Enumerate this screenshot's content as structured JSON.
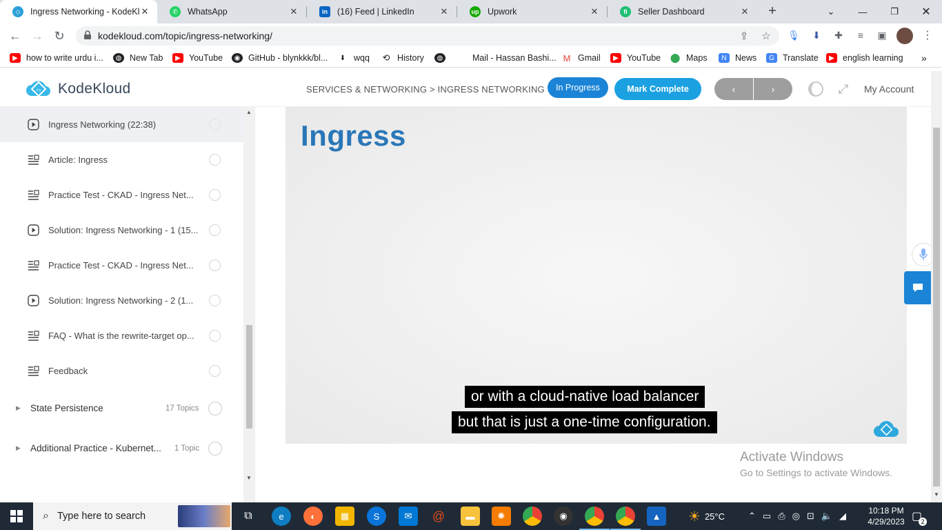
{
  "browser": {
    "tabs": [
      {
        "title": "Ingress Networking - KodeKl",
        "favicon_color": "#2b9fd8",
        "active": true
      },
      {
        "title": "WhatsApp",
        "favicon_color": "#25d366",
        "active": false
      },
      {
        "title": "(16) Feed | LinkedIn",
        "favicon_color": "#0a66c2",
        "active": false
      },
      {
        "title": "Upwork",
        "favicon_color": "#14a800",
        "active": false
      },
      {
        "title": "Seller Dashboard",
        "favicon_color": "#1dbf73",
        "active": false
      }
    ],
    "url": "kodekloud.com/topic/ingress-networking/",
    "bookmarks": [
      {
        "label": "how to write urdu i...",
        "icon": "youtube-icon",
        "color": "#ff0000"
      },
      {
        "label": "New Tab",
        "icon": "globe-icon",
        "color": "#202124"
      },
      {
        "label": "YouTube",
        "icon": "youtube-icon",
        "color": "#ff0000"
      },
      {
        "label": "GitHub - blynkkk/bl...",
        "icon": "github-icon",
        "color": "#202124"
      },
      {
        "label": "wqq",
        "icon": "download-icon",
        "color": "#202124"
      },
      {
        "label": "History",
        "icon": "history-icon",
        "color": "#202124"
      },
      {
        "label": "",
        "icon": "globe-icon",
        "color": "#202124"
      },
      {
        "label": "Mail - Hassan Bashi...",
        "icon": "microsoft-icon",
        "color": "#f25022"
      },
      {
        "label": "Gmail",
        "icon": "gmail-icon",
        "color": "#ea4335"
      },
      {
        "label": "YouTube",
        "icon": "youtube-icon",
        "color": "#ff0000"
      },
      {
        "label": "Maps",
        "icon": "maps-icon",
        "color": "#34a853"
      },
      {
        "label": "News",
        "icon": "news-icon",
        "color": "#4285f4"
      },
      {
        "label": "Translate",
        "icon": "translate-icon",
        "color": "#4285f4"
      },
      {
        "label": "english learning",
        "icon": "youtube-icon",
        "color": "#ff0000"
      }
    ]
  },
  "header": {
    "brand": "KodeKloud",
    "breadcrumb": "SERVICES & NETWORKING > INGRESS NETWORKING",
    "status_label": "In Progress",
    "complete_label": "Mark Complete",
    "prev_label": "‹",
    "next_label": "›",
    "account_label": "My Account"
  },
  "sidebar": {
    "lessons": [
      {
        "label": "Ingress Networking (22:38)",
        "type": "video",
        "current": true
      },
      {
        "label": "Article: Ingress",
        "type": "article",
        "current": false
      },
      {
        "label": "Practice Test - CKAD - Ingress Net...",
        "type": "article",
        "current": false
      },
      {
        "label": "Solution: Ingress Networking - 1 (15...",
        "type": "video",
        "current": false
      },
      {
        "label": "Practice Test - CKAD - Ingress Net...",
        "type": "article",
        "current": false
      },
      {
        "label": "Solution: Ingress Networking - 2 (1...",
        "type": "video",
        "current": false
      },
      {
        "label": "FAQ - What is the rewrite-target op...",
        "type": "article",
        "current": false
      },
      {
        "label": "Feedback",
        "type": "article",
        "current": false
      }
    ],
    "sections": [
      {
        "label": "State Persistence",
        "count": "17 Topics"
      },
      {
        "label": "Additional Practice - Kubernet...",
        "count": "1 Topic"
      }
    ]
  },
  "video": {
    "slide_title": "Ingress",
    "captions": [
      "or with a cloud-native load balancer",
      "but that is just a one-time configuration."
    ]
  },
  "watermark": {
    "line1": "Activate Windows",
    "line2": "Go to Settings to activate Windows."
  },
  "taskbar": {
    "search_placeholder": "Type here to search",
    "weather": "25°C",
    "time": "10:18 PM",
    "date": "4/29/2023",
    "notification_count": "2"
  },
  "colors": {
    "accent": "#1ba1e2",
    "status_pill": "#1b84d6",
    "slide_title": "#2a77b8"
  }
}
